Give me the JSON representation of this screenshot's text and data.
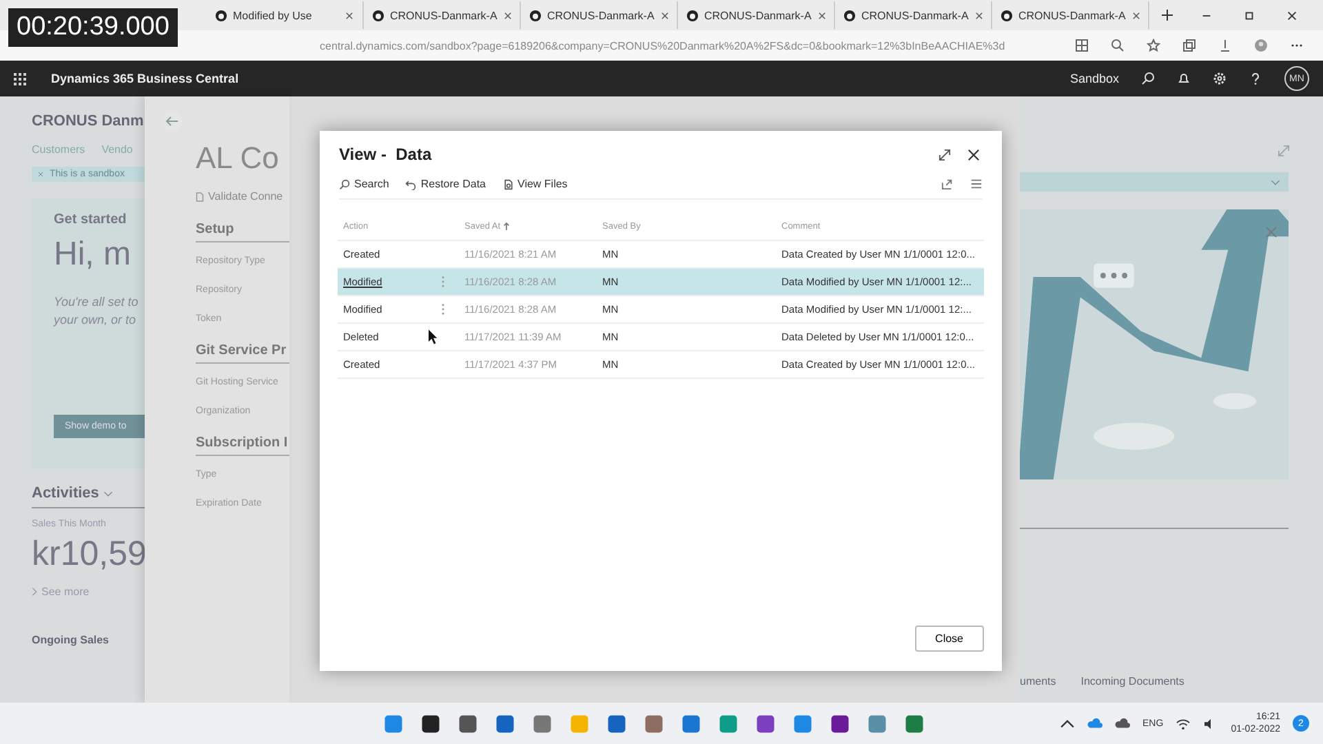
{
  "video_timestamp": "00:20:39.000",
  "browser": {
    "tabs": [
      {
        "label": "Modified by Use"
      },
      {
        "label": "CRONUS-Danmark-A"
      },
      {
        "label": "CRONUS-Danmark-A"
      },
      {
        "label": "CRONUS-Danmark-A"
      },
      {
        "label": "CRONUS-Danmark-A"
      },
      {
        "label": "CRONUS-Danmark-A"
      }
    ],
    "address": "central.dynamics.com/sandbox?page=6189206&company=CRONUS%20Danmark%20A%2FS&dc=0&bookmark=12%3bInBeAACHIAE%3d"
  },
  "app_bar": {
    "title": "Dynamics 365 Business Central",
    "environment": "Sandbox",
    "avatar": "MN"
  },
  "home": {
    "company": "CRONUS Danm",
    "nav": [
      "Customers",
      "Vendo"
    ],
    "banner": "This is a sandbox",
    "card_title": "Get started",
    "greeting": "Hi, m",
    "intro": [
      "You're all set to",
      "your own, or to"
    ],
    "demo_button": "Show demo to",
    "activities": "Activities",
    "kpi_label": "Sales This Month",
    "kpi_value": "kr10,59",
    "see_more": "See more",
    "ongoing": "Ongoing Sales",
    "right_tabs": [
      "uments",
      "Incoming Documents"
    ]
  },
  "panel": {
    "title": "AL Co",
    "action": "Validate Conne",
    "sections": [
      {
        "title": "Setup",
        "fields": [
          "Repository Type",
          "Repository",
          "Token"
        ]
      },
      {
        "title": "Git Service Pr",
        "fields": [
          "Git Hosting Service",
          "Organization"
        ]
      },
      {
        "title": "Subscription I",
        "fields": [
          "Type",
          "Expiration Date"
        ]
      }
    ]
  },
  "dialog": {
    "title": "View -  Data",
    "toolbar": [
      "Search",
      "Restore Data",
      "View Files"
    ],
    "columns": [
      "Action",
      "Saved At",
      "Saved By",
      "Comment"
    ],
    "rows": [
      {
        "cells": [
          "Created",
          "11/16/2021 8:21 AM",
          "MN",
          "Data Created by User MN 1/1/0001 12:0..."
        ],
        "selected": false,
        "menu": false
      },
      {
        "cells": [
          "Modified",
          "11/16/2021 8:28 AM",
          "MN",
          "Data Modified by User MN 1/1/0001 12:..."
        ],
        "selected": true,
        "menu": true
      },
      {
        "cells": [
          "Modified",
          "11/16/2021 8:28 AM",
          "MN",
          "Data Modified by User MN 1/1/0001 12:..."
        ],
        "selected": false,
        "menu": true
      },
      {
        "cells": [
          "Deleted",
          "11/17/2021 11:39 AM",
          "MN",
          "Data Deleted by User MN 1/1/0001 12:0..."
        ],
        "selected": false,
        "menu": false
      },
      {
        "cells": [
          "Created",
          "11/17/2021 4:37 PM",
          "MN",
          "Data Created by User MN 1/1/0001 12:0..."
        ],
        "selected": false,
        "menu": false
      }
    ],
    "close": "Close"
  },
  "taskbar": {
    "language": "ENG",
    "time": "16:21",
    "date": "01-02-2022",
    "notifications": "2"
  }
}
